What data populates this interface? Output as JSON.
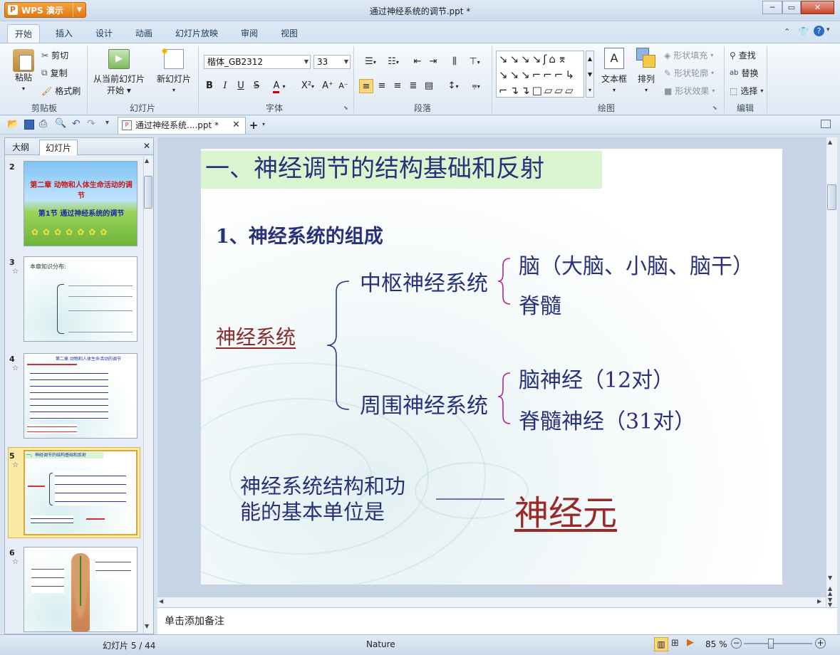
{
  "app": {
    "name": "WPS 演示",
    "doc_title": "通过神经系统的调节.ppt *"
  },
  "tabs": [
    "开始",
    "插入",
    "设计",
    "动画",
    "幻灯片放映",
    "审阅",
    "视图"
  ],
  "ribbon": {
    "clipboard": {
      "paste": "粘贴",
      "cut": "剪切",
      "copy": "复制",
      "format_painter": "格式刷",
      "label": "剪贴板"
    },
    "slides": {
      "from_current": "从当前幻灯片",
      "start": "开始",
      "new_slide": "新幻灯片",
      "label": "幻灯片"
    },
    "font": {
      "name": "楷体_GB2312",
      "size": "33",
      "label": "字体",
      "bold": "B",
      "italic": "I",
      "underline": "U",
      "strike": "S"
    },
    "paragraph": {
      "label": "段落"
    },
    "drawing": {
      "textbox": "文本框",
      "arrange": "排列",
      "fill": "形状填充",
      "outline": "形状轮廓",
      "effects": "形状效果",
      "label": "绘图"
    },
    "edit": {
      "find": "查找",
      "replace": "替换",
      "select": "选择",
      "label": "编辑"
    }
  },
  "doc_tab": {
    "title": "通过神经系统....ppt *"
  },
  "left_pane": {
    "outline_tab": "大纲",
    "slides_tab": "幻灯片",
    "thumbs": [
      {
        "num": "2",
        "line1": "第二章  动物和人体生命活动的调节",
        "line2": "第1节  通过神经系统的调节"
      },
      {
        "num": "3",
        "line1": "本章知识分布:"
      },
      {
        "num": "4",
        "line1": "第二章  动物和人体生命活动的调节"
      },
      {
        "num": "5",
        "line1": "一、神经调节的结构基础和反射"
      },
      {
        "num": "6"
      }
    ]
  },
  "slide": {
    "title": "一、神经调节的结构基础和反射",
    "subtitle": "1、神经系统的组成",
    "root": "神经系统",
    "central": "中枢神经系统",
    "central_items": [
      "脑（大脑、小脑、脑干）",
      "脊髓"
    ],
    "peripheral": "周围神经系统",
    "peripheral_items": [
      "脑神经（12对）",
      "脊髓神经（31对）"
    ],
    "unit_line1": "神经系统结构和功",
    "unit_line2": "能的基本单位是",
    "answer": "神经元"
  },
  "notes_placeholder": "单击添加备注",
  "status": {
    "slide_counter": "幻灯片 5 / 44",
    "theme": "Nature",
    "zoom": "85 %"
  }
}
